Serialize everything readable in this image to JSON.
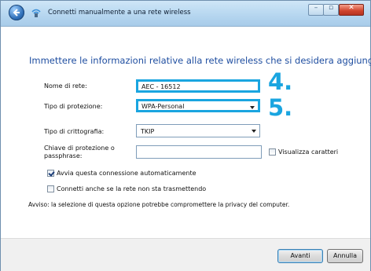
{
  "window": {
    "title": "Connetti manualmente a una rete wireless"
  },
  "heading": "Immettere le informazioni relative alla rete wireless che si desidera aggiungere",
  "form": {
    "network_name_label": "Nome di rete:",
    "network_name_value": "AEC - 16512",
    "security_type_label": "Tipo di protezione:",
    "security_type_value": "WPA-Personal",
    "encryption_type_label": "Tipo di crittografia:",
    "encryption_type_value": "TKIP",
    "security_key_label_line1": "Chiave di protezione o",
    "security_key_label_line2": "passphrase:",
    "security_key_value": "",
    "show_characters_label": "Visualizza caratteri",
    "show_characters_checked": false
  },
  "annotations": {
    "step4": "4.",
    "step5": "5."
  },
  "options": {
    "auto_start_label": "Avvia questa connessione automaticamente",
    "auto_start_checked": true,
    "connect_hidden_label": "Connetti anche se la rete non sta trasmettendo",
    "connect_hidden_checked": false,
    "warning": "Avviso: la selezione di questa opzione potrebbe compromettere la privacy del computer."
  },
  "buttons": {
    "next": "Avanti",
    "cancel": "Annulla"
  },
  "colors": {
    "accent_highlight": "#1aa5e0",
    "heading_blue": "#1f4ea0"
  }
}
